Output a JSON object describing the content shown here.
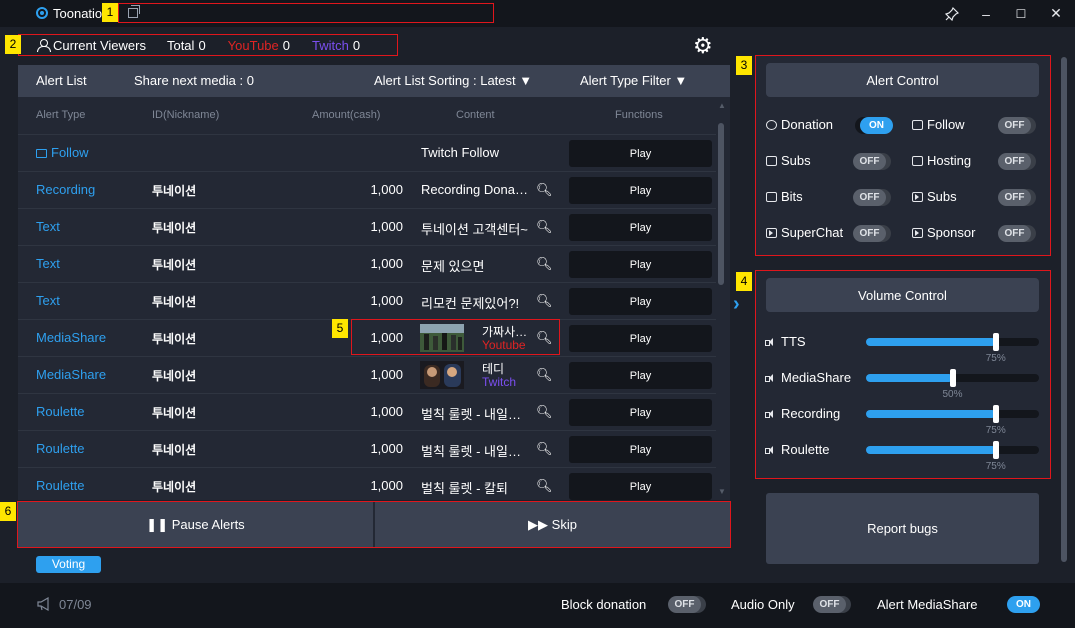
{
  "window": {
    "title": "Toonation",
    "minimize": "–",
    "maximize": "☐",
    "close": "✕",
    "pin": "📌"
  },
  "markers": [
    "1",
    "2",
    "3",
    "4",
    "5",
    "6"
  ],
  "viewers": {
    "current_label": "Current Viewers",
    "total_label": "Total",
    "total_value": "0",
    "youtube_label": "YouTube",
    "youtube_value": "0",
    "twitch_label": "Twitch",
    "twitch_value": "0"
  },
  "alert_list": {
    "title": "Alert List",
    "share_next": "Share next media : 0",
    "sorting": "Alert List Sorting : Latest ▼",
    "type_filter": "Alert Type Filter ▼",
    "columns": [
      "Alert Type",
      "ID(Nickname)",
      "Amount(cash)",
      "Content",
      "Functions"
    ],
    "play_label": "Play",
    "rows": [
      {
        "type": "Follow",
        "nick": "",
        "amount": "",
        "content": "Twitch Follow"
      },
      {
        "type": "Recording",
        "nick": "투네이션",
        "amount": "1,000",
        "content": "Recording Donation"
      },
      {
        "type": "Text",
        "nick": "투네이션",
        "amount": "1,000",
        "content": "투네이션 고객센터~"
      },
      {
        "type": "Text",
        "nick": "투네이션",
        "amount": "1,000",
        "content": "문제 있으면"
      },
      {
        "type": "Text",
        "nick": "투네이션",
        "amount": "1,000",
        "content": "리모컨 문제있어?!"
      },
      {
        "type": "MediaShare",
        "nick": "투네이션",
        "amount": "1,000",
        "content": "가짜사…",
        "source": "Youtube"
      },
      {
        "type": "MediaShare",
        "nick": "투네이션",
        "amount": "1,000",
        "content": "테디",
        "source": "Twitch"
      },
      {
        "type": "Roulette",
        "nick": "투네이션",
        "amount": "1,000",
        "content": "벌칙 룰렛 - 내일도…"
      },
      {
        "type": "Roulette",
        "nick": "투네이션",
        "amount": "1,000",
        "content": "벌칙 룰렛 - 내일도…"
      },
      {
        "type": "Roulette",
        "nick": "투네이션",
        "amount": "1,000",
        "content": "벌칙 룰렛 - 칼퇴"
      }
    ]
  },
  "actions": {
    "pause": "❚❚ Pause Alerts",
    "skip": "▶▶ Skip"
  },
  "voting": "Voting",
  "alert_control": {
    "title": "Alert Control",
    "items": [
      {
        "label": "Donation",
        "state": "ON"
      },
      {
        "label": "Follow",
        "state": "OFF"
      },
      {
        "label": "Subs",
        "state": "OFF"
      },
      {
        "label": "Hosting",
        "state": "OFF"
      },
      {
        "label": "Bits",
        "state": "OFF"
      },
      {
        "label": "Subs",
        "state": "OFF"
      },
      {
        "label": "SuperChat",
        "state": "OFF"
      },
      {
        "label": "Sponsor",
        "state": "OFF"
      }
    ]
  },
  "volume_control": {
    "title": "Volume Control",
    "items": [
      {
        "label": "TTS",
        "value": 75,
        "pct_label": "75%"
      },
      {
        "label": "MediaShare",
        "value": 50,
        "pct_label": "50%"
      },
      {
        "label": "Recording",
        "value": 75,
        "pct_label": "75%"
      },
      {
        "label": "Roulette",
        "value": 75,
        "pct_label": "75%"
      }
    ]
  },
  "report_bugs": "Report bugs",
  "footer": {
    "count": "07/09",
    "block_donation": "Block donation",
    "block_donation_state": "OFF",
    "audio_only": "Audio Only",
    "audio_only_state": "OFF",
    "alert_mediashare": "Alert MediaShare",
    "alert_mediashare_state": "ON"
  },
  "colors": {
    "accent": "#2ea0ef",
    "youtube": "#e02424",
    "twitch": "#7b4ff0",
    "panel": "#232834",
    "header": "#3b4252"
  }
}
